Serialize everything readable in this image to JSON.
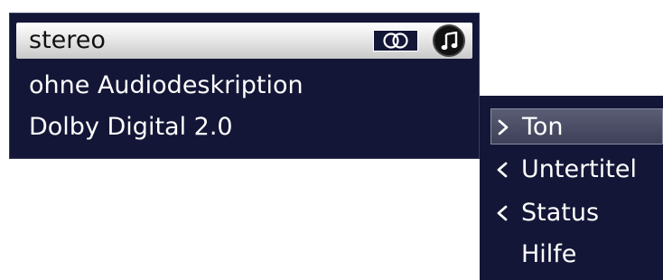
{
  "audio_tracks": {
    "items": [
      {
        "label": "stereo",
        "selected": true
      },
      {
        "label": "ohne Audiodeskription",
        "selected": false
      },
      {
        "label": "Dolby Digital 2.0",
        "selected": false
      }
    ],
    "icons": [
      "stereo-icon",
      "music-note-icon"
    ]
  },
  "menu": {
    "items": [
      {
        "label": "Ton",
        "icon": "chevron-right-icon",
        "selected": true
      },
      {
        "label": "Untertitel",
        "icon": "chevron-left-icon",
        "selected": false
      },
      {
        "label": "Status",
        "icon": "chevron-left-icon",
        "selected": false
      },
      {
        "label": "Hilfe",
        "icon": "",
        "selected": false
      }
    ]
  },
  "colors": {
    "panel_background": "#131636",
    "selection_light": "#e8e8e8",
    "selection_dark": "#4a4d64",
    "text": "#ffffff"
  }
}
